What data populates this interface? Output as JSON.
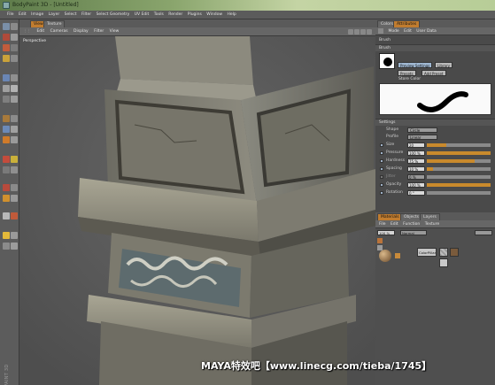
{
  "window": {
    "title": "BodyPaint 3D - [Untitled]"
  },
  "menubar": [
    "File",
    "Edit",
    "Image",
    "Layer",
    "Select",
    "Filter",
    "Select Geometry",
    "UV Edit",
    "Tools",
    "Render",
    "Plugins",
    "Window",
    "Help"
  ],
  "view": {
    "tabs": [
      "View",
      "Texture"
    ],
    "menu": [
      "Edit",
      "Cameras",
      "Display",
      "Filter",
      "View"
    ],
    "viewport_label": "Perspective"
  },
  "left_toolbar": {
    "vertical_label": "BODYPAINT 3D"
  },
  "right_panel": {
    "tabs": [
      "Colors",
      "Attributes"
    ],
    "menu": [
      "Mode",
      "Edit",
      "User Data"
    ],
    "section": "Brush",
    "brush_header": "Brush",
    "preset_buttons": [
      "Preview Settings",
      "Library",
      "Presets",
      "Add Preset"
    ],
    "store_color": "Store Color",
    "settings_header": "Settings",
    "shape": {
      "label": "Shape",
      "value": "Circle"
    },
    "profile": {
      "label": "Profile",
      "value": "Linear"
    },
    "size": {
      "label": "Size",
      "value": "20",
      "fraction": 0.3
    },
    "pressure": {
      "label": "Pressure",
      "value": "100 %",
      "fraction": 1.0
    },
    "hardness": {
      "label": "Hardness",
      "value": "75 %",
      "fraction": 0.75
    },
    "spacing": {
      "label": "Spacing",
      "value": "10 %",
      "fraction": 0.1
    },
    "jitter": {
      "label": "Jitter",
      "value": "0 %",
      "fraction": 0.0
    },
    "opacity": {
      "label": "Opacity",
      "value": "100 %",
      "fraction": 1.0
    },
    "rotation": {
      "label": "Rotation",
      "value": "0 °",
      "fraction": 0.0
    }
  },
  "materials_panel": {
    "tabs": [
      "Materials",
      "Objects",
      "Layers"
    ],
    "menu": [
      "File",
      "Edit",
      "Function",
      "Texture"
    ],
    "zoom": "100 %",
    "mode": "Normal",
    "material_name": "ColorPillar"
  },
  "watermark": "MAYA特效吧【www.linecg.com/tieba/1745】",
  "colors": {
    "accent": "#c07c2f",
    "panel": "#4a4a4a",
    "viewport": "#595959"
  }
}
